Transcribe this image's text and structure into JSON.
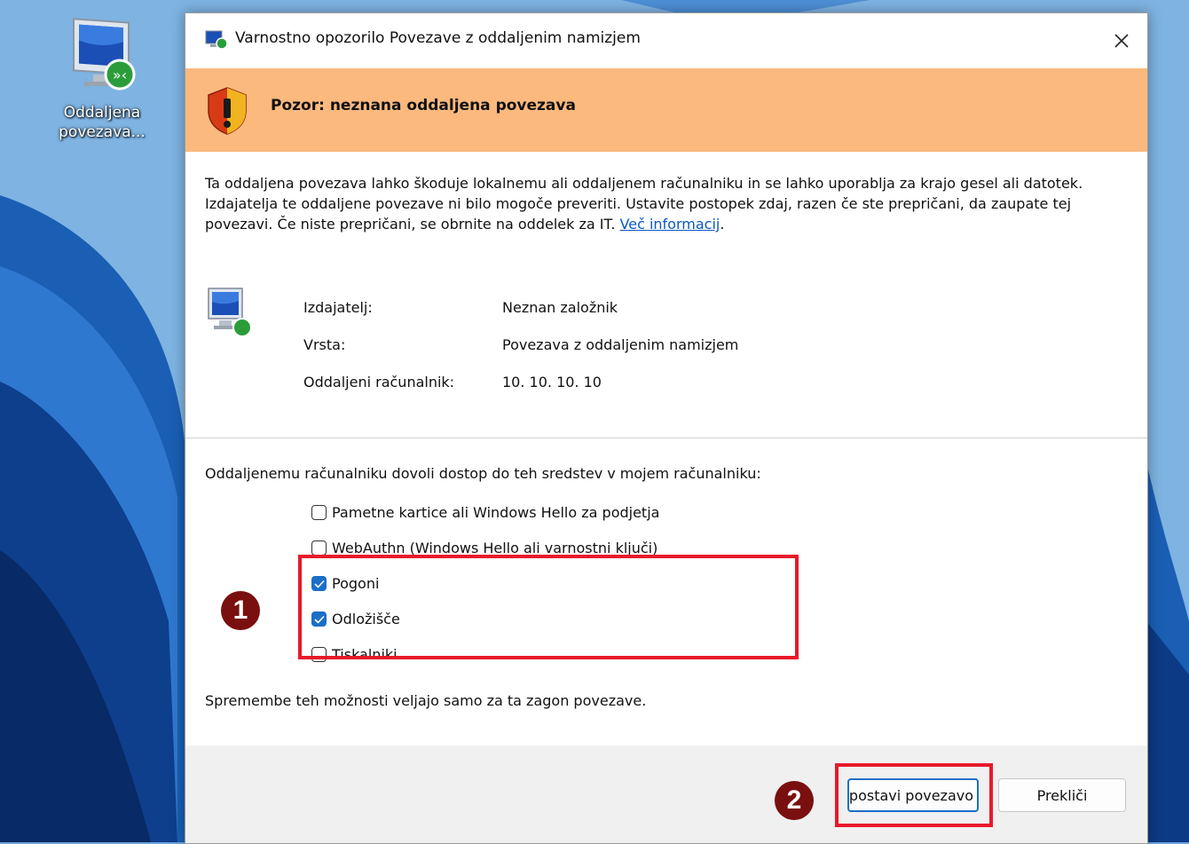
{
  "desktop": {
    "icon_label": "Oddaljena povezava..."
  },
  "dialog": {
    "title": "Varnostno opozorilo Povezave z oddaljenim namizjem",
    "warning_heading": "Pozor: neznana oddaljena povezava",
    "description": "Ta oddaljena povezava lahko škoduje lokalnemu ali oddaljenem računalniku in se lahko uporablja za krajo gesel ali datotek. Izdajatelja te oddaljene povezave ni bilo mogoče preveriti. Ustavite postopek zdaj, razen če ste prepričani, da zaupate tej povezavi. Če niste prepričani, se obrnite na oddelek za IT.",
    "more_info_link": "Več informacij",
    "info": [
      {
        "label": "Izdajatelj:",
        "value": "Neznan založnik"
      },
      {
        "label": "Vrsta:",
        "value": "Povezava z oddaljenim namizjem"
      },
      {
        "label": "Oddaljeni računalnik:",
        "value": "10. 10. 10. 10"
      }
    ],
    "permissions_heading": "Oddaljenemu računalniku dovoli dostop do teh sredstev v mojem računalniku:",
    "permissions": [
      {
        "label": "Pametne kartice ali Windows Hello za podjetja",
        "checked": false
      },
      {
        "label": "WebAuthn (Windows Hello ali varnostni ključi)",
        "checked": false
      },
      {
        "label": "Pogoni",
        "checked": true
      },
      {
        "label": "Odložišče",
        "checked": true
      },
      {
        "label": "Tiskalniki",
        "checked": false
      }
    ],
    "note": "Spremembe teh možnosti veljajo samo za ta zagon povezave.",
    "connect_button": "Vzpostavi povezavo",
    "cancel_button": "Prekliči"
  },
  "annotations": {
    "badge1": "1",
    "badge2": "2",
    "highlight_color": "#e8192b"
  },
  "colors": {
    "warning_bar": "#fbb97e",
    "accent": "#1b6fc8",
    "link": "#0a58c2"
  }
}
